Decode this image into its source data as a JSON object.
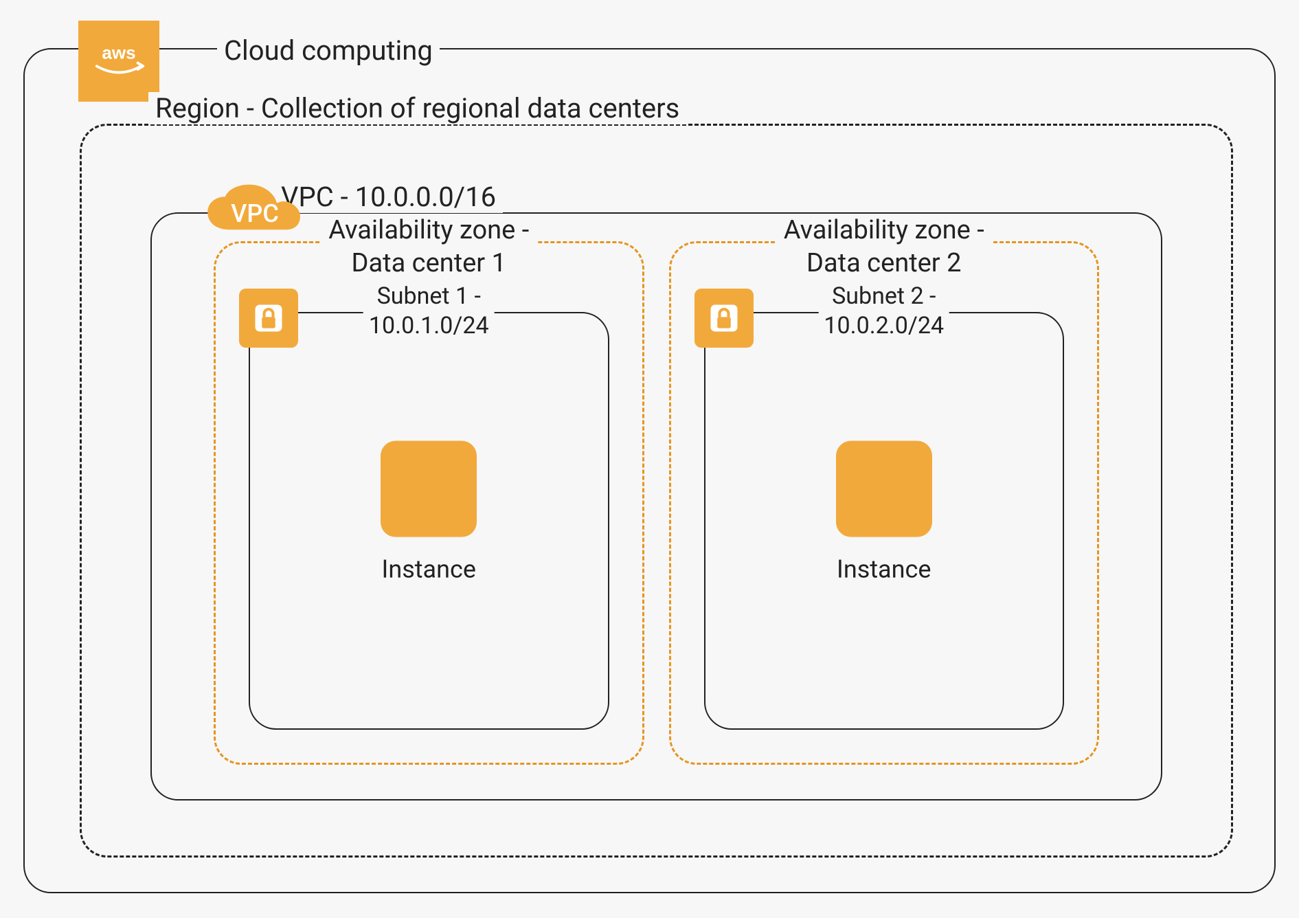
{
  "colors": {
    "accent": "#f2a93b",
    "ink": "#222222"
  },
  "cloud": {
    "title": "Cloud computing",
    "badge_label": "aws"
  },
  "region": {
    "title": "Region - Collection of regional data centers"
  },
  "vpc": {
    "title": "VPC - 10.0.0.0/16",
    "icon_label": "VPC",
    "availability_zones": [
      {
        "title_line1": "Availability zone -",
        "title_line2": "Data center 1",
        "subnet": {
          "title_line1": "Subnet 1 -",
          "title_line2": "10.0.1.0/24",
          "instance_label": "Instance"
        }
      },
      {
        "title_line1": "Availability zone -",
        "title_line2": "Data center 2",
        "subnet": {
          "title_line1": "Subnet 2 -",
          "title_line2": "10.0.2.0/24",
          "instance_label": "Instance"
        }
      }
    ]
  }
}
